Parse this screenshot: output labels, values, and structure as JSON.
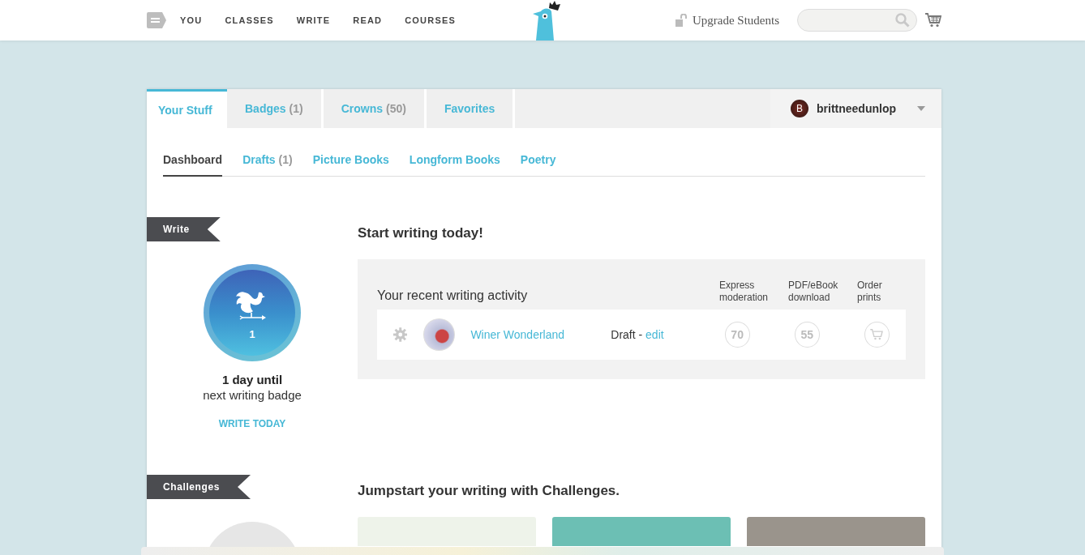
{
  "nav": {
    "items": [
      "YOU",
      "CLASSES",
      "WRITE",
      "READ",
      "COURSES"
    ],
    "upgrade": "Upgrade Students"
  },
  "tabs": [
    {
      "label": "Your Stuff",
      "selected": true
    },
    {
      "label": "Badges",
      "count": "(1)",
      "selected": false
    },
    {
      "label": "Crowns",
      "count": "(50)",
      "selected": false
    },
    {
      "label": "Favorites",
      "selected": false
    }
  ],
  "user": {
    "initial": "B",
    "name": "brittneedunlop"
  },
  "subtabs": [
    {
      "label": "Dashboard",
      "selected": true
    },
    {
      "label": "Drafts",
      "count": "(1)",
      "selected": false
    },
    {
      "label": "Picture Books",
      "selected": false
    },
    {
      "label": "Longform Books",
      "selected": false
    },
    {
      "label": "Poetry",
      "selected": false
    }
  ],
  "write": {
    "ribbon": "Write",
    "badge_number": "1",
    "countdown": "1 day until",
    "countdown_detail": "next writing badge",
    "action": "WRITE TODAY"
  },
  "activity": {
    "heading": "Start writing today!",
    "title": "Your recent writing activity",
    "columns": [
      "Express moderation",
      "PDF/eBook download",
      "Order prints"
    ],
    "rows": [
      {
        "title": "Winer Wonderland",
        "status": "Draft -",
        "edit": "edit",
        "express": "70",
        "pdf": "55"
      }
    ]
  },
  "challenges": {
    "ribbon": "Challenges",
    "heading": "Jumpstart your writing with Challenges."
  }
}
